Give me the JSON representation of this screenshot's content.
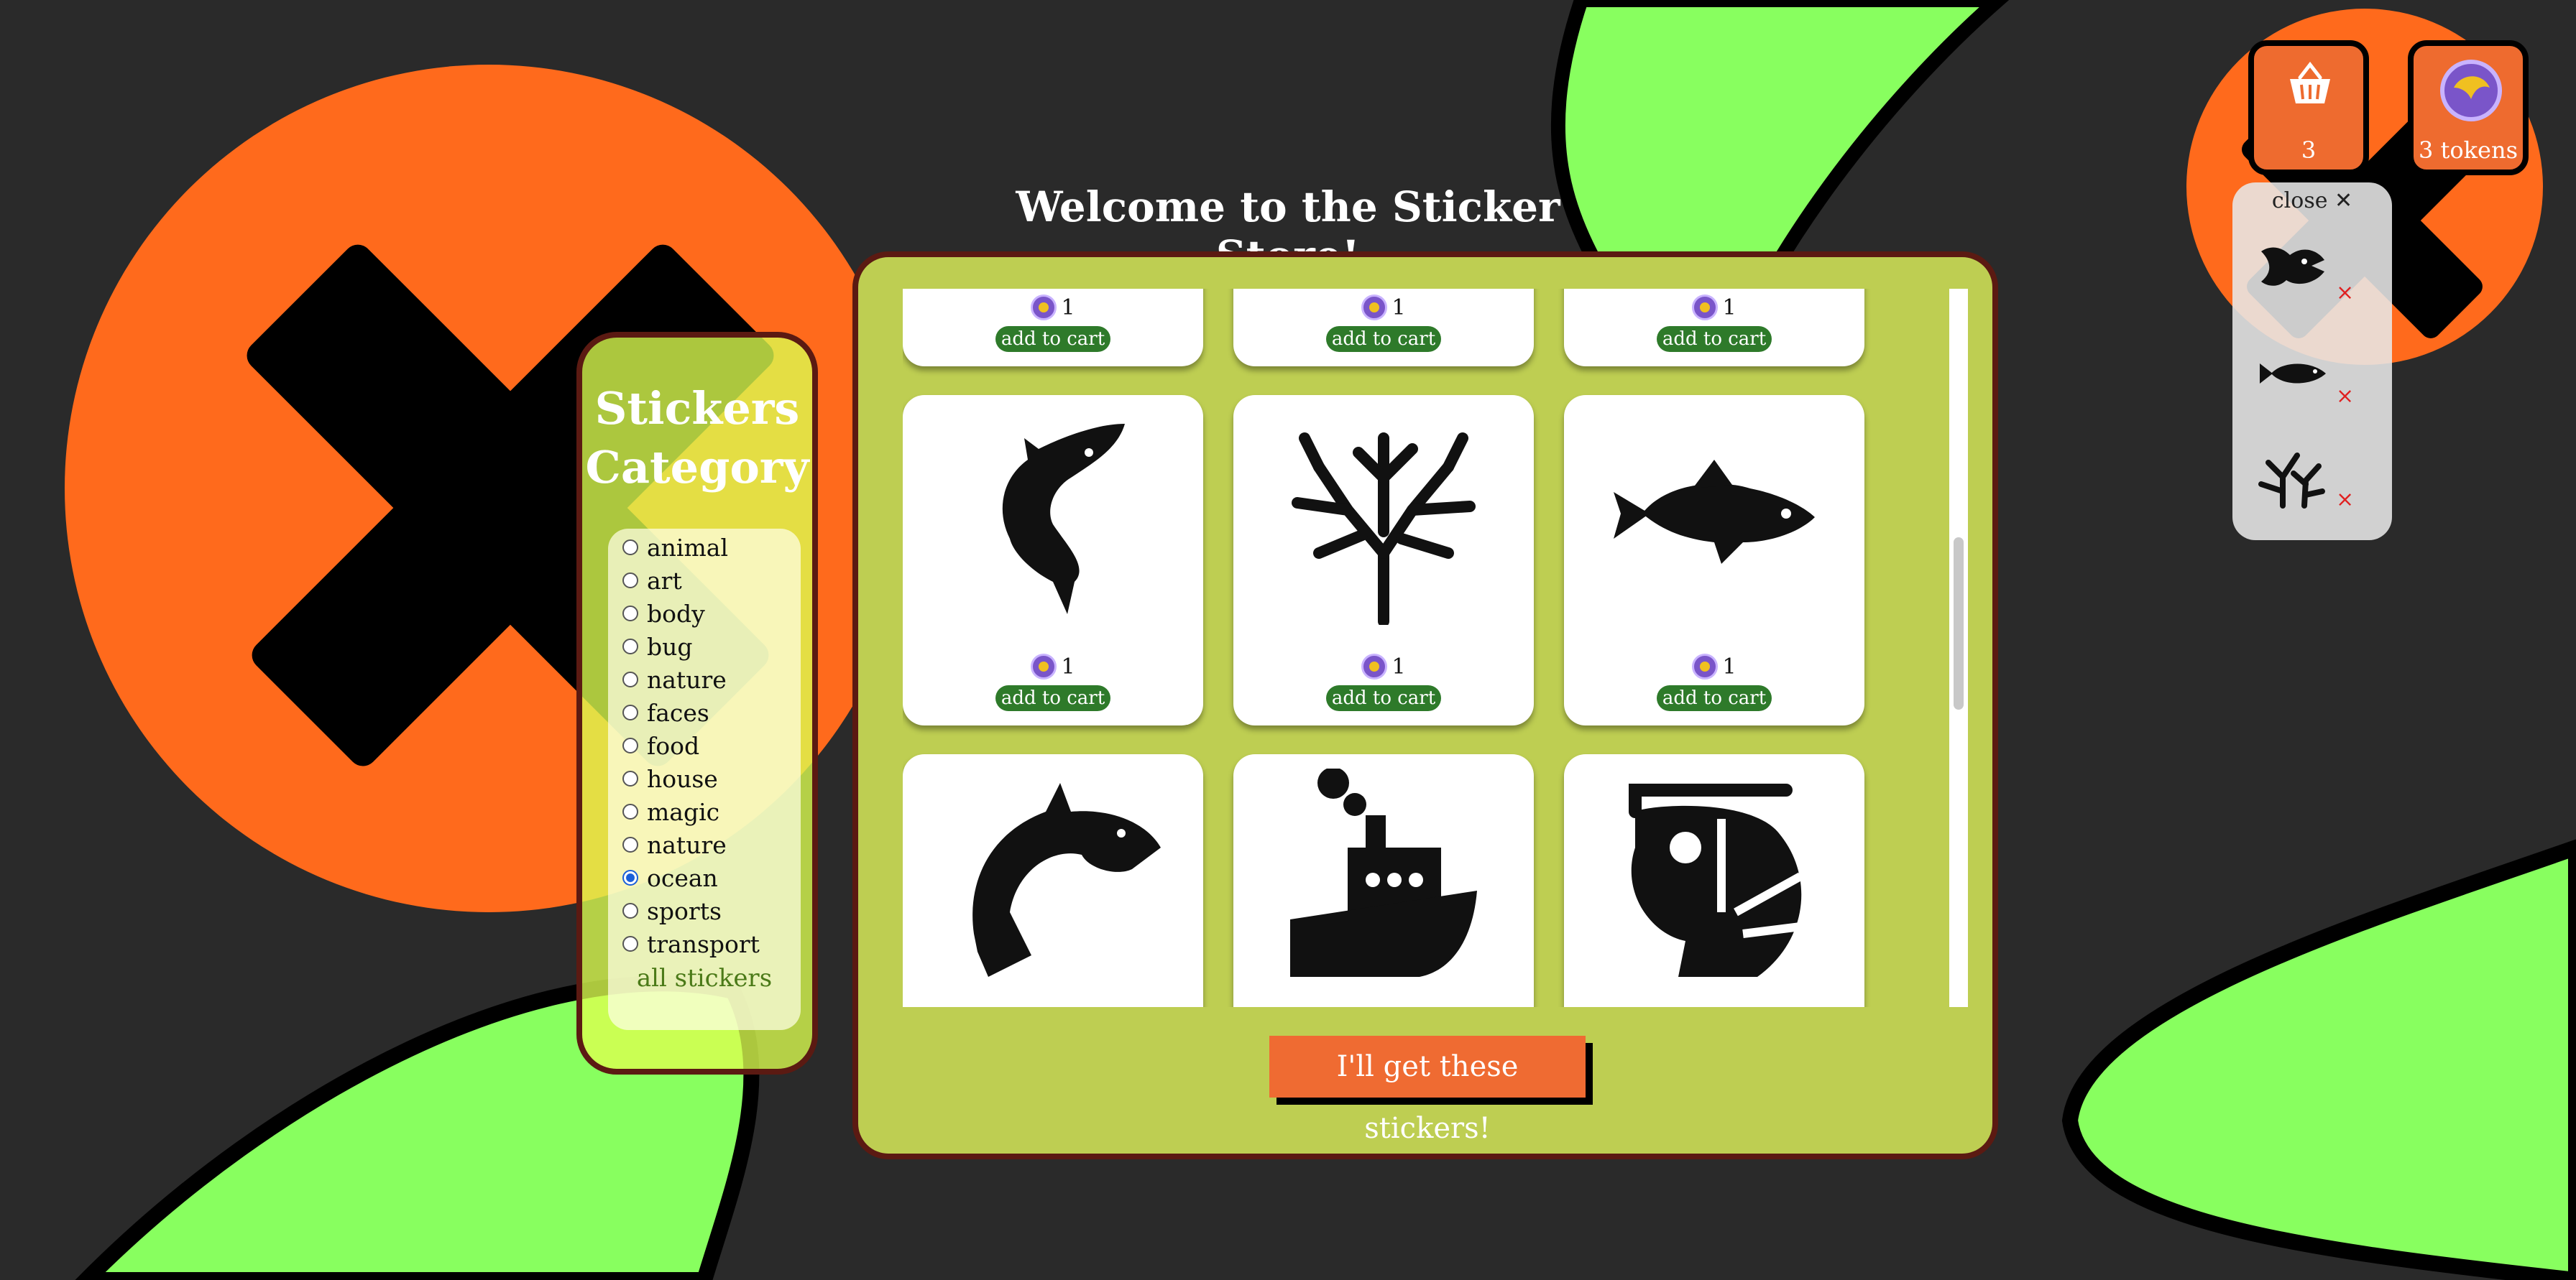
{
  "header": {
    "title": "Welcome to the Sticker Store!"
  },
  "categories": {
    "title": "Stickers Category",
    "options": [
      "animal",
      "art",
      "body",
      "bug",
      "nature",
      "faces",
      "food",
      "house",
      "magic",
      "nature",
      "ocean",
      "sports",
      "transport"
    ],
    "selected": "ocean",
    "all_link": "all stickers"
  },
  "stickers": [
    {
      "icon": "sticker-hidden-1",
      "price": "1",
      "button": "add to cart"
    },
    {
      "icon": "sticker-hidden-2",
      "price": "1",
      "button": "add to cart"
    },
    {
      "icon": "sticker-hidden-3",
      "price": "1",
      "button": "add to cart"
    },
    {
      "icon": "shark-icon",
      "price": "1",
      "button": "add to cart"
    },
    {
      "icon": "coral-icon",
      "price": "1",
      "button": "add to cart"
    },
    {
      "icon": "fish-icon",
      "price": "1",
      "button": "add to cart"
    },
    {
      "icon": "dolphin-icon",
      "price": "",
      "button": ""
    },
    {
      "icon": "boat-icon",
      "price": "",
      "button": ""
    },
    {
      "icon": "shrimp-icon",
      "price": "",
      "button": ""
    }
  ],
  "buy_button": "I'll get these stickers!",
  "cart": {
    "count": "3",
    "icon": "basket-icon"
  },
  "tokens": {
    "label": "3 tokens",
    "icon": "token-icon"
  },
  "cart_panel": {
    "close_label": "close ✕",
    "items": [
      {
        "icon": "angler-fish-icon",
        "remove": "×"
      },
      {
        "icon": "small-fish-icon",
        "remove": "×"
      },
      {
        "icon": "seaweed-icon",
        "remove": "×"
      }
    ]
  },
  "colors": {
    "accent_orange": "#ee6b2f",
    "lime": "#88ff5f",
    "panel_green": "#bece52",
    "button_green": "#2e7a2a"
  }
}
